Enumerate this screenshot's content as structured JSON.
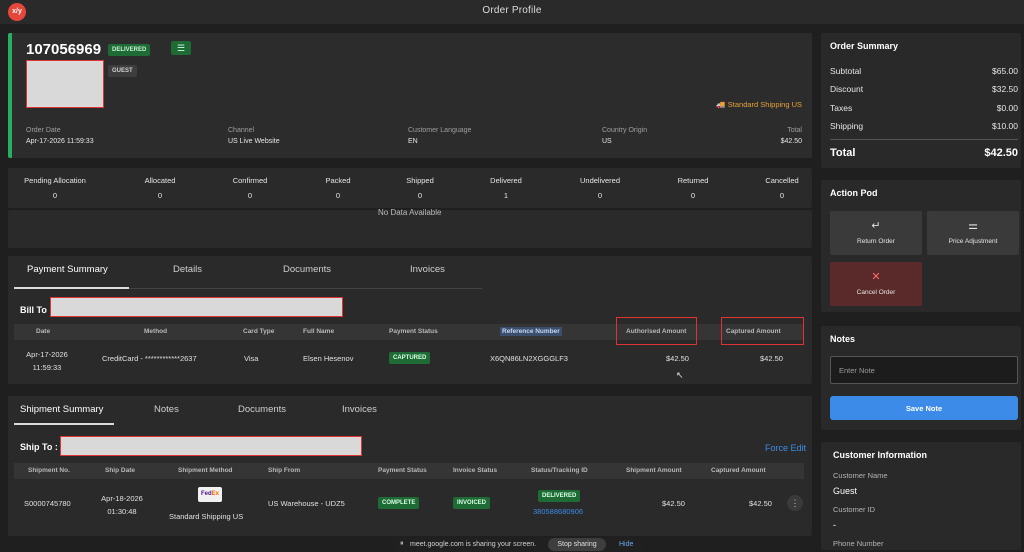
{
  "window": {
    "title": "Order Profile",
    "logo_text": "x/y"
  },
  "header": {
    "order_number": "107056969",
    "status_badge": "DELIVERED",
    "customer_type_badge": "GUEST",
    "shipping_tag": "Standard Shipping US",
    "fields": [
      {
        "label": "Order Date",
        "value": "Apr-17-2026 11:59:33"
      },
      {
        "label": "Channel",
        "value": "US Live Website"
      },
      {
        "label": "Customer Language",
        "value": "EN"
      },
      {
        "label": "Country Origin",
        "value": "US"
      },
      {
        "label": "Total",
        "value": "$42.50"
      }
    ]
  },
  "status_counts": [
    {
      "label": "Pending Allocation",
      "value": "0"
    },
    {
      "label": "Allocated",
      "value": "0"
    },
    {
      "label": "Confirmed",
      "value": "0"
    },
    {
      "label": "Packed",
      "value": "0"
    },
    {
      "label": "Shipped",
      "value": "0"
    },
    {
      "label": "Delivered",
      "value": "1"
    },
    {
      "label": "Undelivered",
      "value": "0"
    },
    {
      "label": "Returned",
      "value": "0"
    },
    {
      "label": "Cancelled",
      "value": "0"
    }
  ],
  "no_data_text": "No Data Available",
  "payment": {
    "tabs": [
      "Payment Summary",
      "Details",
      "Documents",
      "Invoices"
    ],
    "bill_to_label": "Bill To",
    "columns": [
      "Date",
      "Method",
      "Card Type",
      "Full Name",
      "Payment Status",
      "Reference Number",
      "Authorised Amount",
      "Captured Amount"
    ],
    "row": {
      "date_line1": "Apr-17-2026",
      "date_line2": "11:59:33",
      "method": "CreditCard - ************2637",
      "card_type": "Visa",
      "full_name": "Elsen Hesenov",
      "status": "CAPTURED",
      "reference": "X6QN86LN2XGGGLF3",
      "authorised": "$42.50",
      "captured": "$42.50"
    }
  },
  "shipment": {
    "tabs": [
      "Shipment Summary",
      "Notes",
      "Documents",
      "Invoices"
    ],
    "ship_to_label": "Ship To :",
    "force_edit": "Force Edit",
    "columns": [
      "Shipment No.",
      "Ship Date",
      "Shipment Method",
      "Ship From",
      "Payment Status",
      "Invoice Status",
      "Status/Tracking ID",
      "Shipment Amount",
      "Captured Amount"
    ],
    "row": {
      "shipment_no": "S0000745780",
      "ship_date_line1": "Apr-18-2026",
      "ship_date_line2": "01:30:48",
      "carrier_logo_fe": "Fed",
      "carrier_logo_ex": "Ex",
      "method": "Standard Shipping US",
      "ship_from": "US Warehouse - UDZ5",
      "payment_status": "COMPLETE",
      "invoice_status": "INVOICED",
      "status": "DELIVERED",
      "tracking_id": "380588680906",
      "shipment_amount": "$42.50",
      "captured_amount": "$42.50"
    }
  },
  "order_summary": {
    "title": "Order Summary",
    "rows": [
      {
        "label": "Subtotal",
        "value": "$65.00"
      },
      {
        "label": "Discount",
        "value": "$32.50"
      },
      {
        "label": "Taxes",
        "value": "$0.00"
      },
      {
        "label": "Shipping",
        "value": "$10.00"
      }
    ],
    "total_label": "Total",
    "total_value": "$42.50"
  },
  "action_pod": {
    "title": "Action Pod",
    "return_order": "Return Order",
    "price_adjustment": "Price Adjustment",
    "cancel_order": "Cancel Order"
  },
  "notes": {
    "title": "Notes",
    "placeholder": "Enter Note",
    "save_label": "Save Note"
  },
  "customer_info": {
    "title": "Customer Information",
    "name_label": "Customer Name",
    "name_value": "Guest",
    "id_label": "Customer ID",
    "id_value": "-",
    "phone_label": "Phone Number"
  },
  "screen_share": {
    "message": "meet.google.com is sharing your screen.",
    "stop": "Stop sharing",
    "hide": "Hide"
  },
  "colors": {
    "accent": "#3d8be8",
    "success": "#27ae60",
    "warning": "#e8a23a",
    "danger": "#e03434"
  }
}
